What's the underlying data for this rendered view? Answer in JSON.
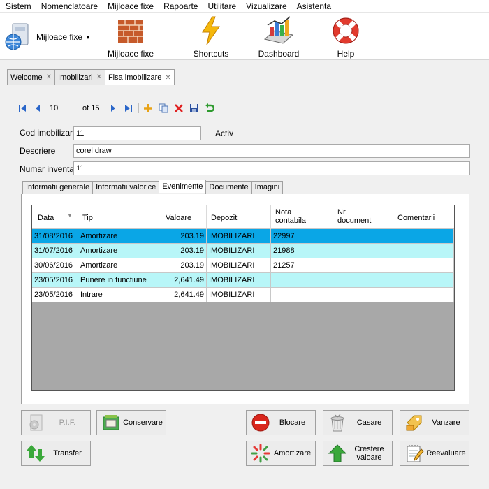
{
  "menu": [
    "Sistem",
    "Nomenclatoare",
    "Mijloace fixe",
    "Rapoarte",
    "Utilitare",
    "Vizualizare",
    "Asistenta"
  ],
  "ribbon": {
    "dropdown_label": "Mijloace fixe",
    "buttons": [
      {
        "label": "Mijloace fixe",
        "icon": "brick-wall-icon"
      },
      {
        "label": "Shortcuts",
        "icon": "lightning-icon"
      },
      {
        "label": "Dashboard",
        "icon": "chart-icon"
      },
      {
        "label": "Help",
        "icon": "lifebuoy-icon"
      }
    ]
  },
  "doc_tabs": [
    {
      "label": "Welcome",
      "active": false
    },
    {
      "label": "Imobilizari",
      "active": false
    },
    {
      "label": "Fisa imobilizare",
      "active": true
    }
  ],
  "navigator": {
    "position": "10",
    "total_text": "of 15"
  },
  "form": {
    "cod_label": "Cod imobilizare",
    "cod_value": "11",
    "activ_label": "Activ",
    "descriere_label": "Descriere",
    "descriere_value": "corel draw",
    "numar_label": "Numar inventar",
    "numar_value": "11"
  },
  "inner_tabs": [
    {
      "label": "Informatii generale",
      "active": false
    },
    {
      "label": "Informatii valorice",
      "active": false
    },
    {
      "label": "Evenimente",
      "active": true
    },
    {
      "label": "Documente",
      "active": false
    },
    {
      "label": "Imagini",
      "active": false
    }
  ],
  "grid": {
    "columns": [
      {
        "label": "Data"
      },
      {
        "label": "Tip"
      },
      {
        "label": "Valoare"
      },
      {
        "label": "Depozit"
      },
      {
        "label": "Nota\ncontabila"
      },
      {
        "label": "Nr.\ndocument"
      },
      {
        "label": "Comentarii"
      }
    ],
    "rows": [
      {
        "data": "31/08/2016",
        "tip": "Amortizare",
        "valoare": "203.19",
        "depozit": "IMOBILIZARI",
        "nota": "22997",
        "nr": "",
        "comentarii": "",
        "style": "selected"
      },
      {
        "data": "31/07/2016",
        "tip": "Amortizare",
        "valoare": "203.19",
        "depozit": "IMOBILIZARI",
        "nota": "21988",
        "nr": "",
        "comentarii": "",
        "style": "alt"
      },
      {
        "data": "30/06/2016",
        "tip": "Amortizare",
        "valoare": "203.19",
        "depozit": "IMOBILIZARI",
        "nota": "21257",
        "nr": "",
        "comentarii": "",
        "style": "normal"
      },
      {
        "data": "23/05/2016",
        "tip": "Punere in functiune",
        "valoare": "2,641.49",
        "depozit": "IMOBILIZARI",
        "nota": "",
        "nr": "",
        "comentarii": "",
        "style": "alt"
      },
      {
        "data": "23/05/2016",
        "tip": "Intrare",
        "valoare": "2,641.49",
        "depozit": "IMOBILIZARI",
        "nota": "",
        "nr": "",
        "comentarii": "",
        "style": "normal"
      }
    ]
  },
  "actions": {
    "pif": "P.I.F.",
    "conservare": "Conservare",
    "transfer": "Transfer",
    "blocare": "Blocare",
    "casare": "Casare",
    "vanzare": "Vanzare",
    "amortizare": "Amortizare",
    "crestere": "Crestere\nvaloare",
    "reevaluare": "Reevaluare"
  },
  "colors": {
    "selected_row": "#0aa6e6",
    "alt_row": "#b8f6f8",
    "grid_empty": "#a8a8a8"
  }
}
